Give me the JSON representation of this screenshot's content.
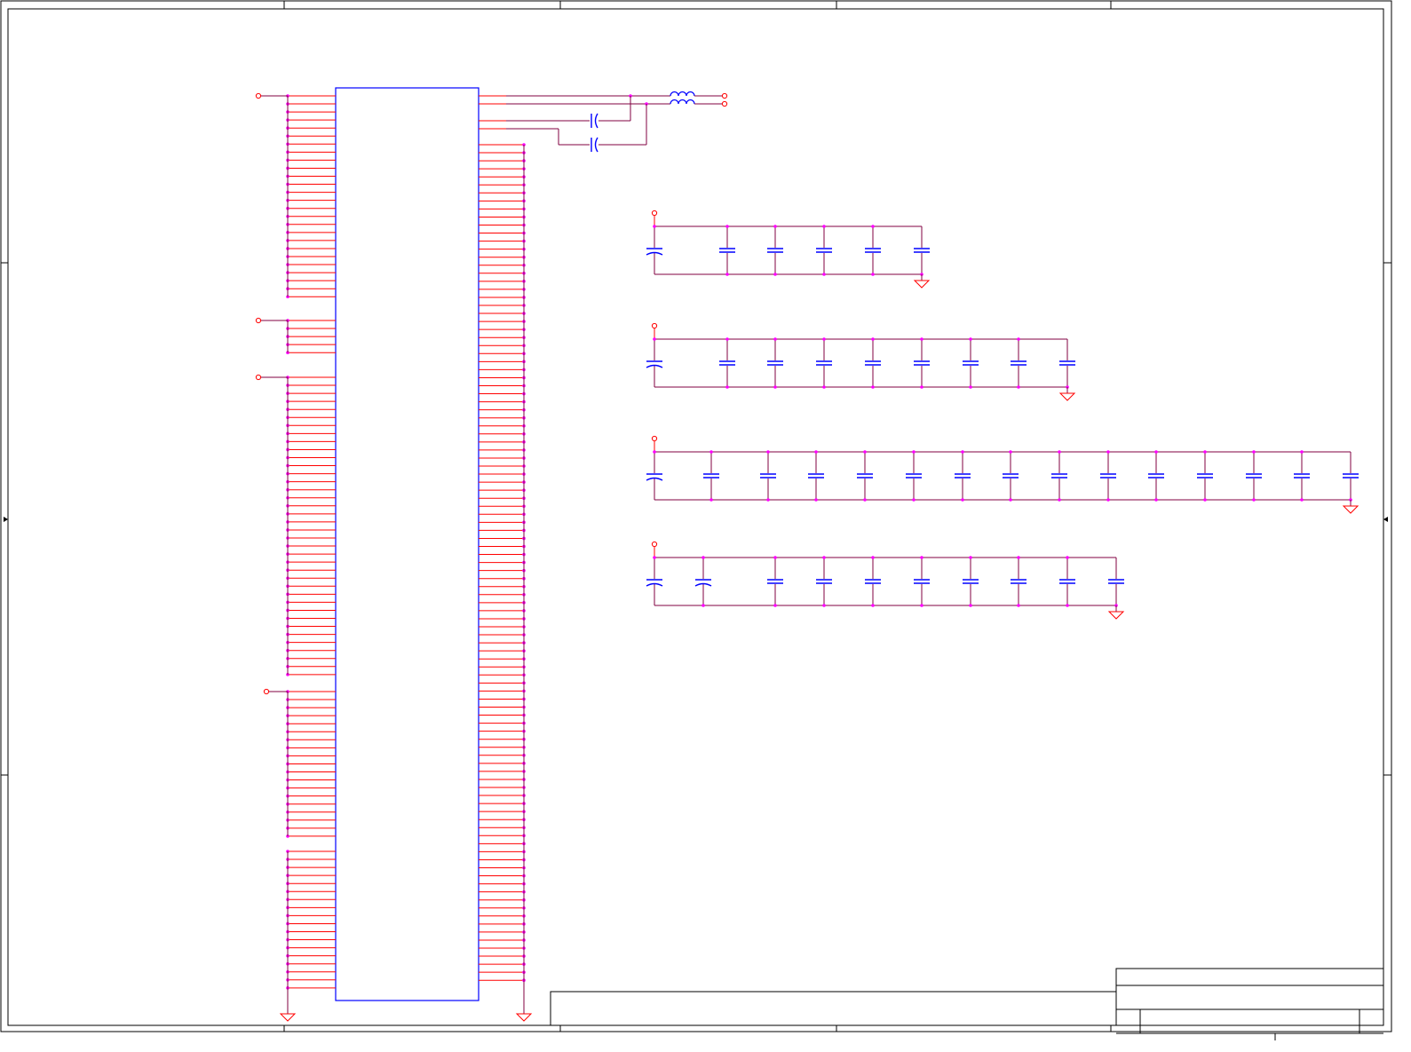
{
  "colors": {
    "background": "#ffffff",
    "frame": "#000000",
    "component": "#0000ff",
    "wire_pin": "#ff0000",
    "net": "#800040",
    "junction": "#ff00ff"
  },
  "icons": {
    "ground": "ground-symbol-icon",
    "power_port": "power-port-circle-icon",
    "capacitor": "capacitor-icon",
    "polarized_capacitor": "polarized-capacitor-icon",
    "inductor": "inductor-icon",
    "border_arrow": "border-arrow-icon"
  },
  "schematic": {
    "decoupling_groups": [
      {
        "capacitor_count": 6,
        "polarized_count": 1
      },
      {
        "capacitor_count": 9,
        "polarized_count": 1
      },
      {
        "capacitor_count": 15,
        "polarized_count": 1
      },
      {
        "capacitor_count": 10,
        "polarized_count": 2
      }
    ],
    "ic_left_power_groups": [
      {
        "pin_count": 26
      },
      {
        "pin_count": 5
      },
      {
        "pin_count": 38
      },
      {
        "pin_count": 19
      },
      {
        "pin_count": 18
      }
    ],
    "ic_right_ground_pin_count": 105,
    "ferrite_beads": 2,
    "filter_capacitors": 2
  },
  "title_block": {
    "title": "",
    "size": "",
    "number": "",
    "revision": "",
    "date": "",
    "sheet": "",
    "file": "",
    "drawn_by": ""
  }
}
